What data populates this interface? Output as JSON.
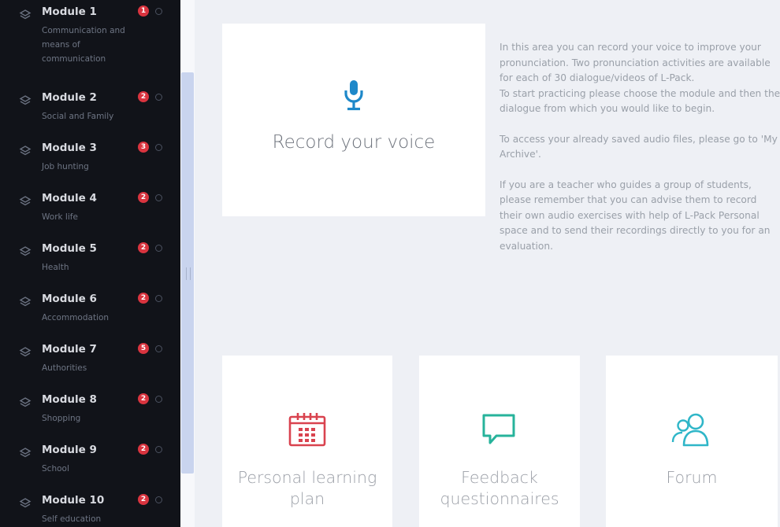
{
  "sidebar": {
    "modules": [
      {
        "title": "Module 1",
        "badge": "1",
        "subtitle": "Communication and means of communication"
      },
      {
        "title": "Module 2",
        "badge": "2",
        "subtitle": "Social and Family"
      },
      {
        "title": "Module 3",
        "badge": "3",
        "subtitle": "Job hunting"
      },
      {
        "title": "Module 4",
        "badge": "2",
        "subtitle": "Work life"
      },
      {
        "title": "Module 5",
        "badge": "2",
        "subtitle": "Health"
      },
      {
        "title": "Module 6",
        "badge": "2",
        "subtitle": "Accommodation"
      },
      {
        "title": "Module 7",
        "badge": "5",
        "subtitle": "Authorities"
      },
      {
        "title": "Module 8",
        "badge": "2",
        "subtitle": "Shopping"
      },
      {
        "title": "Module 9",
        "badge": "2",
        "subtitle": "School"
      },
      {
        "title": "Module 10",
        "badge": "2",
        "subtitle": "Self education"
      }
    ]
  },
  "record": {
    "title": "Record your voice",
    "icon": "microphone-icon"
  },
  "info": {
    "p1": "In this area you can record your voice to improve your pronunciation. Two pronunciation activities are available for each of 30 dialogue/videos of L-Pack.",
    "p1b": "To start practicing please choose the module and then the dialogue from which you would like to begin.",
    "p2": "To access your already saved audio files, please go to 'My Archive'.",
    "p3": "If you are a teacher who guides a group of students, please remember that you can advise them to record their own audio exercises with help of L-Pack Personal space and to send their recordings directly to you for an evaluation."
  },
  "cards": {
    "plan": {
      "title": "Personal learning plan",
      "icon": "calendar-icon"
    },
    "feedback": {
      "title": "Feedback questionnaires",
      "icon": "speech-bubble-icon"
    },
    "forum": {
      "title": "Forum",
      "icon": "users-icon"
    }
  },
  "colors": {
    "sidebar_bg": "#111319",
    "badge": "#d9343f",
    "mic": "#1e88c9",
    "calendar": "#d9434f",
    "feedback": "#27b39b",
    "forum": "#2fb6c8"
  }
}
